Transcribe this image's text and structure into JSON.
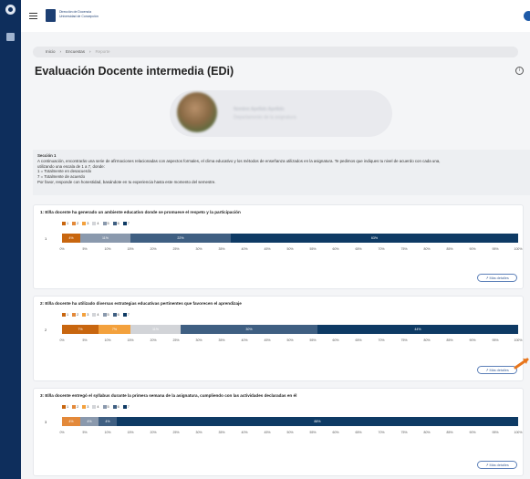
{
  "header": {
    "university_line1": "Dirección de Docencia",
    "university_line2": "Universidad de Concepción"
  },
  "breadcrumb": {
    "items": [
      "Inicio",
      "Encuestas",
      "Reporte"
    ]
  },
  "page_title": "Evaluación Docente intermedia (EDi)",
  "profile": {
    "name": "Nombre Apellido Apellido",
    "department": "Departamento de la asignatura"
  },
  "section": {
    "heading": "Sección 1",
    "lines": [
      "A continuación, encontrarás una serie de afirmaciones relacionadas con aspectos formales, el clima educativo y los métodos de enseñanza utilizados en la asignatura. Te pedimos que indiques tu nivel de acuerdo con cada una,",
      "utilizando una escala de 1 a 7, donde:",
      "1 = Totalmente en desacuerdo",
      "7 = Totalmente de acuerdo",
      "Por favor, responde con honestidad, basándote en tu experiencia hasta este momento del semestre."
    ]
  },
  "legend": {
    "labels": [
      "1",
      "2",
      "3",
      "4",
      "5",
      "6",
      "7"
    ],
    "colors": [
      "#c8660f",
      "#e3893a",
      "#f3a13d",
      "#d2d4d8",
      "#8a99ad",
      "#3f5f82",
      "#0e3a64"
    ]
  },
  "axis_ticks": [
    "0%",
    "5%",
    "10%",
    "15%",
    "20%",
    "25%",
    "30%",
    "35%",
    "40%",
    "45%",
    "50%",
    "55%",
    "60%",
    "65%",
    "70%",
    "75%",
    "80%",
    "85%",
    "90%",
    "95%",
    "100%"
  ],
  "more_label": "Más detalles",
  "chart_data": [
    {
      "type": "bar",
      "title": "1: El/la docente ha generado un ambiente educativo donde se promueve el respeto y la participación",
      "category": "1",
      "segments": [
        {
          "level": 1,
          "value": 4,
          "label": "4%"
        },
        {
          "level": 5,
          "value": 11,
          "label": "11%"
        },
        {
          "level": 6,
          "value": 22,
          "label": "22%"
        },
        {
          "level": 7,
          "value": 63,
          "label": "63%"
        }
      ],
      "xlim": [
        0,
        100
      ]
    },
    {
      "type": "bar",
      "title": "2: El/la docente ha utilizado diversas estrategias educativas pertinentes que favorecen el aprendizaje",
      "category": "2",
      "segments": [
        {
          "level": 1,
          "value": 8,
          "label": "7%"
        },
        {
          "level": 3,
          "value": 7,
          "label": "7%"
        },
        {
          "level": 4,
          "value": 11,
          "label": "11%"
        },
        {
          "level": 6,
          "value": 30,
          "label": "30%"
        },
        {
          "level": 7,
          "value": 44,
          "label": "44%"
        }
      ],
      "xlim": [
        0,
        100
      ]
    },
    {
      "type": "bar",
      "title": "3: El/la docente entregó el syllabus durante la primera semana de la asignatura, cumpliendo con las actividades declaradas en él",
      "category": "3",
      "segments": [
        {
          "level": 2,
          "value": 4,
          "label": "4%"
        },
        {
          "level": 5,
          "value": 4,
          "label": "4%"
        },
        {
          "level": 6,
          "value": 4,
          "label": "4%"
        },
        {
          "level": 7,
          "value": 88,
          "label": "88%"
        }
      ],
      "xlim": [
        0,
        100
      ]
    }
  ]
}
